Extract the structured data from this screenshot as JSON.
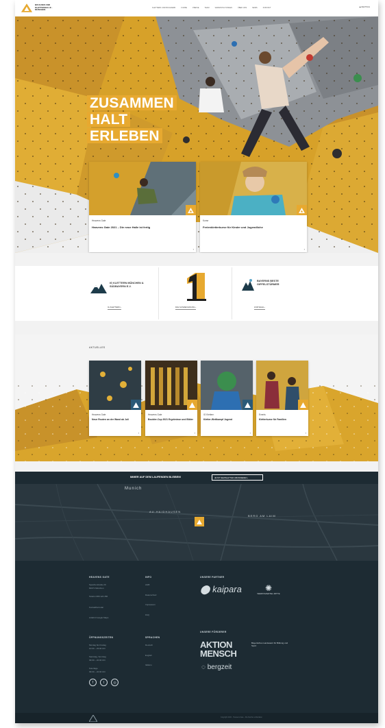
{
  "nav": {
    "logo_text": "BOULDER AND KLETTERHALLE · MÜNCHEN",
    "menu": [
      "KLETTERN UND BOULDERN",
      "KURSE",
      "PREISE",
      "TEAM",
      "VERANSTALTUNGEN",
      "ÜBER UNS",
      "NEWS",
      "KONTAKT"
    ],
    "lang": "DEUTSCH"
  },
  "hero": {
    "lines": [
      "ZUSAMMEN",
      "HALT",
      "ERLEBEN"
    ]
  },
  "hero_cards": [
    {
      "category": "Heavens Gate",
      "title": "Heavens Gate 2021 – Die neue Halle ist fertig"
    },
    {
      "category": "Kurse",
      "title": "Ferienkletterkurse für Kinder und Jugendliche"
    }
  ],
  "partners": [
    {
      "name": "IG KLETTERN MÜNCHEN & SÜDBAYERN E.V.",
      "button": "IG KLETTERN"
    },
    {
      "name": "",
      "button": "DAV AUSZEICHNUNG"
    },
    {
      "name": "BAYERNS BESTE GIPFELSTÜRMER",
      "button": "ZUR WAHL"
    }
  ],
  "news": {
    "heading": "AKTUELLES",
    "items": [
      {
        "category": "Heavens Gate",
        "title": "Neue Routen an der Wand ab Juli"
      },
      {
        "category": "Heavens Gate",
        "title": "Boulder-Cup 2021 Ergebnisse und Bilder"
      },
      {
        "category": "IG Klettern",
        "title": "Kletter-Wettkampf Jugend"
      },
      {
        "category": "Events",
        "title": "Kletterkurse für Familien"
      }
    ]
  },
  "newsletter": {
    "text": "IMMER AUF DEM LAUFENDEN BLEIBEN!",
    "button": "JETZT NEWSLETTER ABONNIEREN"
  },
  "map": {
    "labels": [
      "Munich",
      "AU-HAIDHAUSEN",
      "BERG AM LAIM"
    ]
  },
  "footer": {
    "col1_head": "HEAVENS GATE",
    "col1_lines": [
      "Speicherstraße 20",
      "81671 München",
      "Telefon 089 123 456",
      "Kontaktformular",
      "Anfahrt Google Maps"
    ],
    "col2_head": "INFO",
    "col2_lines": [
      "AGB",
      "Datenschutz",
      "Impressum",
      "FAQ"
    ],
    "col3_head": "UNSERE PARTNER",
    "col3_partners": [
      "kaipara",
      "WERKSVIERTEL MITTE"
    ],
    "col4_head": "ÖFFNUNGSZEITEN",
    "col4_lines": [
      "Montag bis Freitag",
      "10:00 – 23:00 Uhr",
      "Samstag, Sonntag",
      "09:00 – 22:00 Uhr",
      "Feiertage",
      "09:00 – 22:00 Uhr"
    ],
    "col5_head": "SPRACHEN",
    "col5_lines": [
      "Deutsch",
      "English",
      "Italiano"
    ],
    "col6_head": "UNSERE FÖRDERER",
    "col6_partners": [
      "AKTION MENSCH",
      "Bayerisches Landesamt für Bildung und Sport",
      "bergzeit"
    ],
    "social": [
      "f",
      "t",
      "◎"
    ],
    "copyright": "Copyright 2021 · Heavens Gate · Alle Rechte vorbehalten"
  },
  "colors": {
    "accent": "#e7a930",
    "dark": "#1d2b33"
  }
}
